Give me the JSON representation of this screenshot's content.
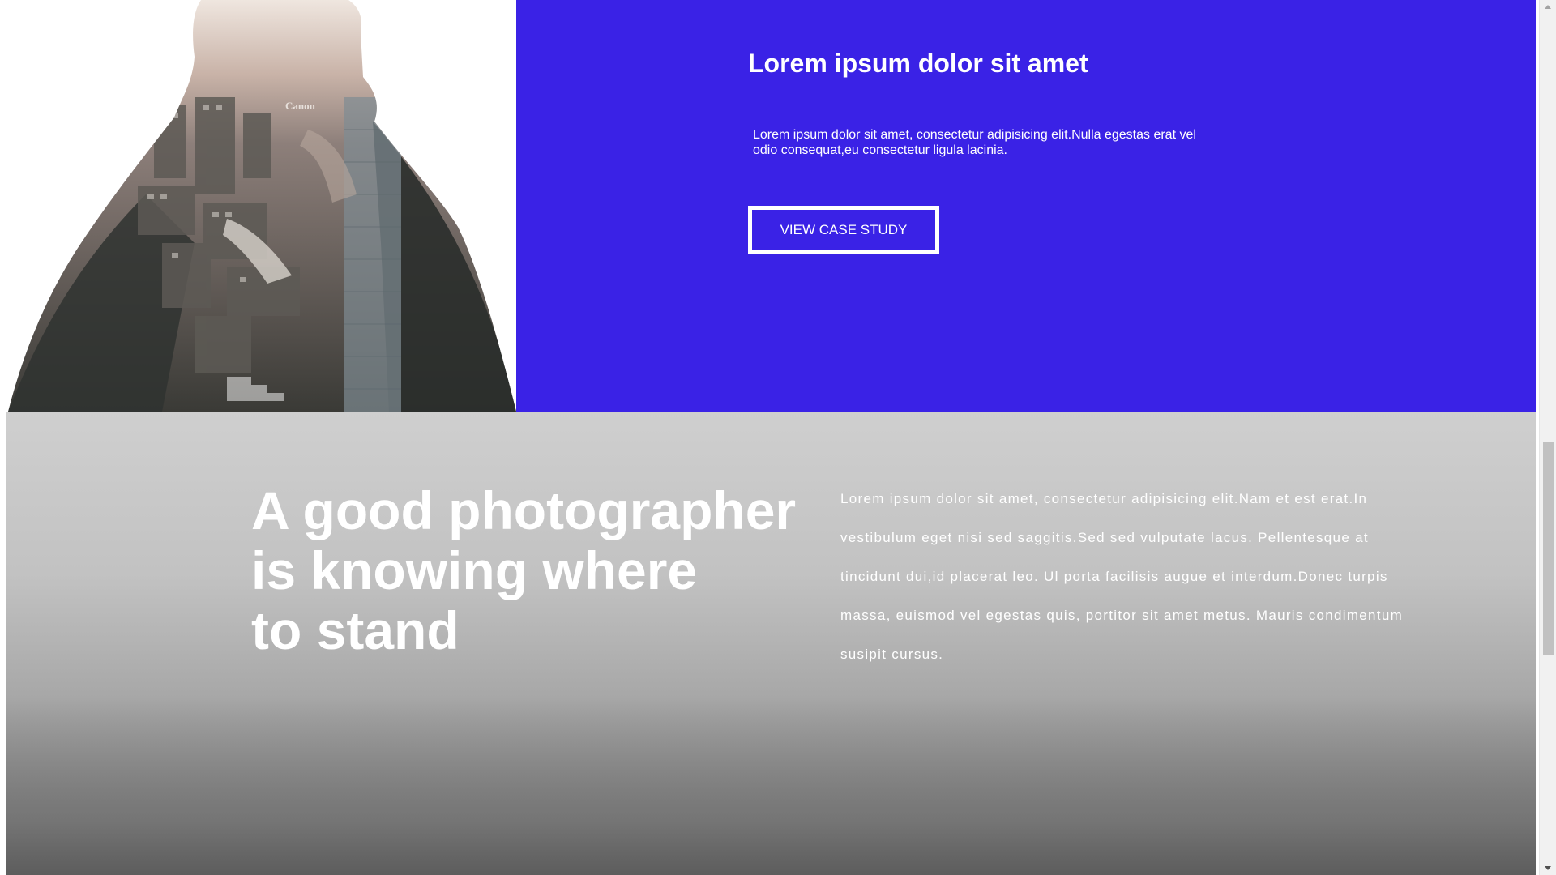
{
  "case_study": {
    "title": "Lorem ipsum dolor sit amet",
    "text": "Lorem ipsum dolor sit amet, consectetur adipisicing elit.Nulla egestas erat vel odio consequat,eu consectetur ligula lacinia.",
    "button_label": "VIEW CASE STUDY"
  },
  "photo": {
    "description_icon": "double-exposure-photographer-image",
    "camera_brand_text": "Canon"
  },
  "quote_section": {
    "heading_lines": [
      "A good photographer",
      "is knowing where",
      "to stand"
    ],
    "text": "Lorem ipsum dolor sit amet, consectetur adipisicing elit.Nam et est erat.In vestibulum eget nisi sed saggitis.Sed sed vulputate lacus. Pellentesque at tincidunt dui,id placerat leo. Ul porta facilisis augue et interdum.Donec turpis massa, euismod vel egestas quis, portitor sit amet metus. Mauris condimentum susipit cursus."
  },
  "colors": {
    "accent_blue": "#3a22e6",
    "text_white": "#ffffff",
    "fog_gray": "#c2c2c2"
  }
}
